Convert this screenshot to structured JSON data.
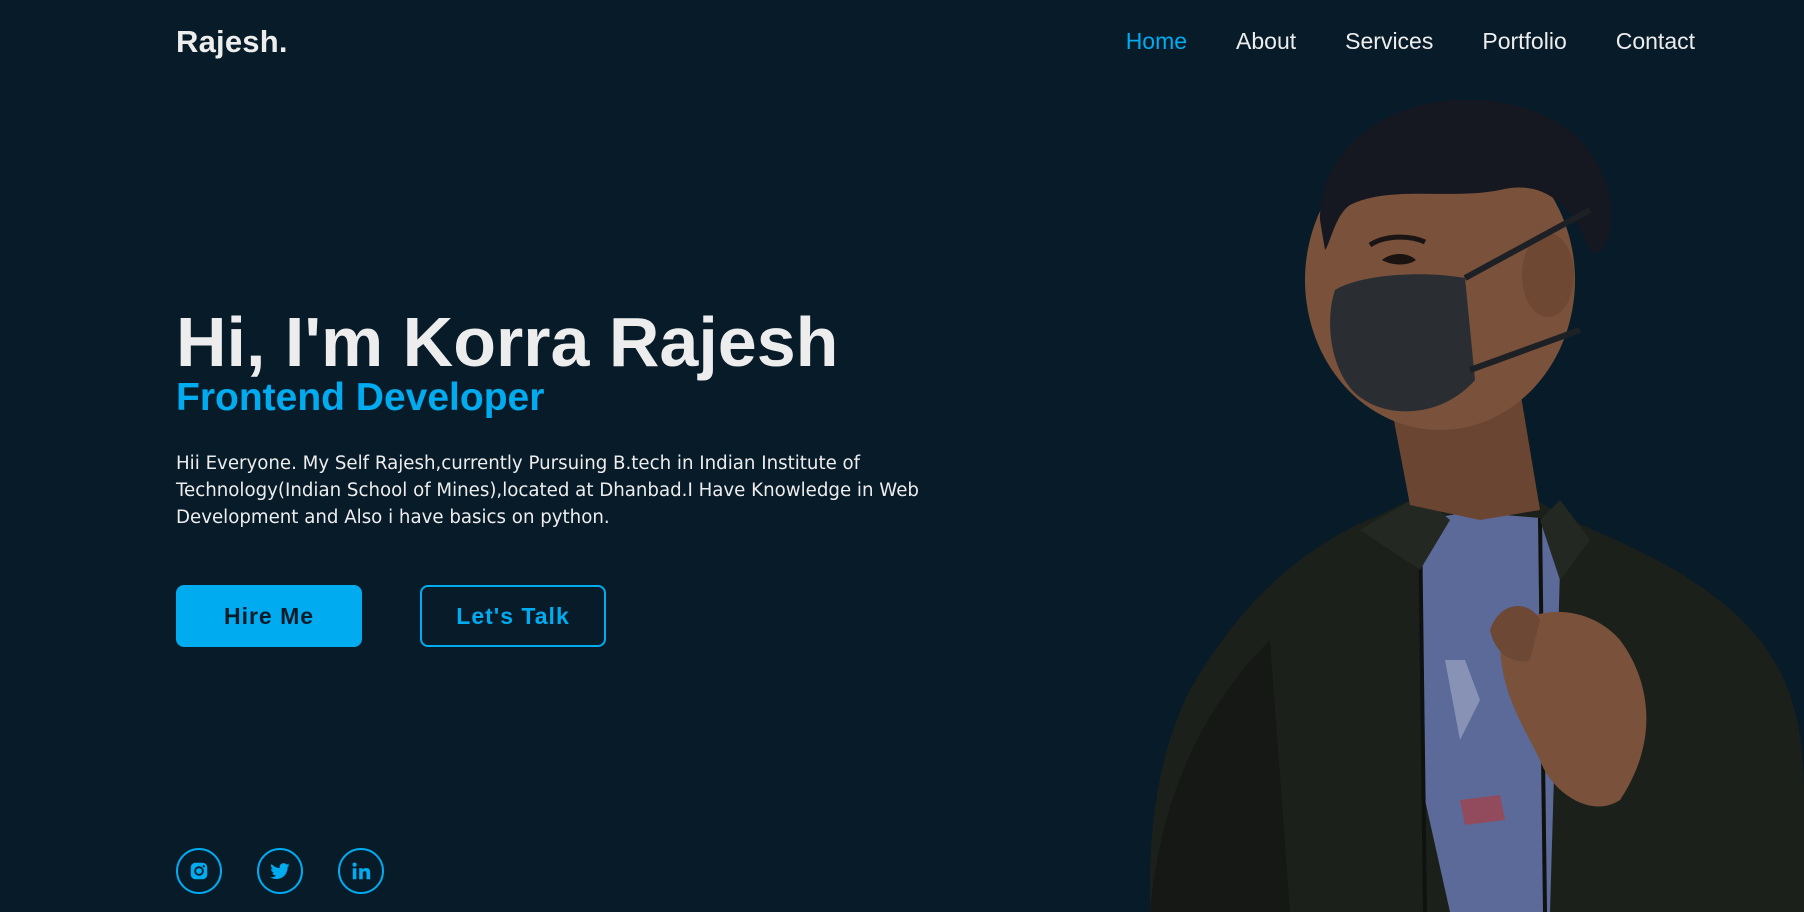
{
  "header": {
    "logo": "Rajesh.",
    "nav": [
      {
        "label": "Home",
        "active": true
      },
      {
        "label": "About",
        "active": false
      },
      {
        "label": "Services",
        "active": false
      },
      {
        "label": "Portfolio",
        "active": false
      },
      {
        "label": "Contact",
        "active": false
      }
    ]
  },
  "hero": {
    "title": "Hi, I'm Korra Rajesh",
    "subtitle": "Frontend Developer",
    "description": "Hii Everyone. My Self Rajesh,currently Pursuing B.tech in Indian Institute of Technology(Indian School of Mines),located at Dhanbad.I Have Knowledge in Web Development and Also i have basics on python.",
    "buttons": {
      "primary": "Hire Me",
      "secondary": "Let's Talk"
    }
  },
  "social": [
    {
      "icon": "instagram-icon"
    },
    {
      "icon": "twitter-icon"
    },
    {
      "icon": "linkedin-icon"
    }
  ],
  "colors": {
    "background": "#081b29",
    "accent": "#00abf0",
    "text": "#ededed"
  }
}
